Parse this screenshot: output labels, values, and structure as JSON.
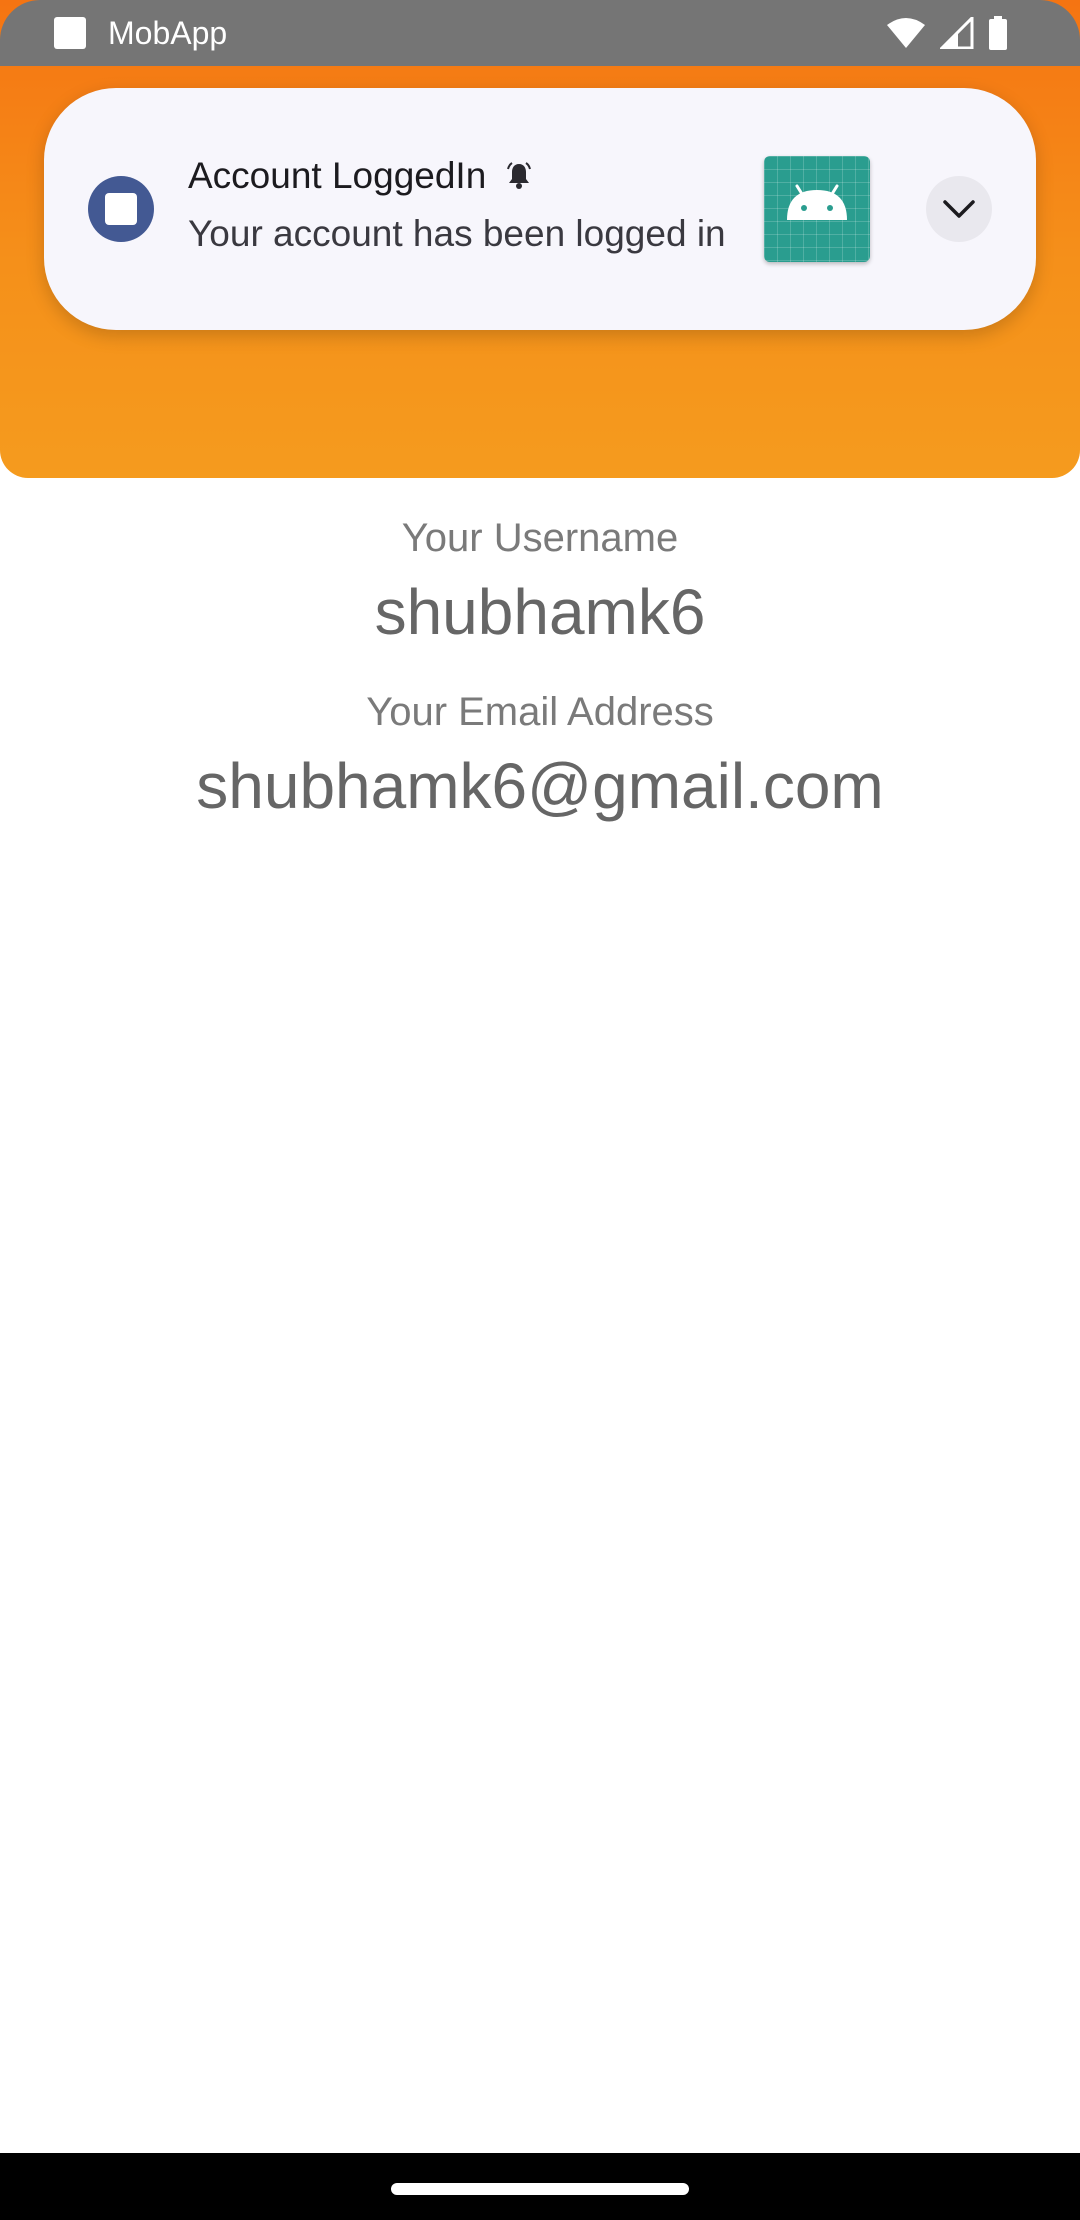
{
  "status_bar": {
    "app_name": "MobApp",
    "icons": [
      "wifi-icon",
      "signal-icon",
      "battery-icon"
    ]
  },
  "notification": {
    "app_icon": "app-square-icon",
    "title": "Account LoggedIn",
    "alert_icon": "bell-icon",
    "text": "Your account has been logged in",
    "image": "android-logo-icon",
    "expand_icon": "chevron-down-icon"
  },
  "profile": {
    "username_label": "Your Username",
    "username": "shubhamk6",
    "email_label": "Your Email Address",
    "email": "shubhamk6@gmail.com"
  },
  "colors": {
    "header_orange": "#f5901a",
    "status_bar_gray": "#757575",
    "notification_bg": "#f7f6fc",
    "app_icon_blue": "#435993",
    "android_teal": "#2a9d8f"
  }
}
